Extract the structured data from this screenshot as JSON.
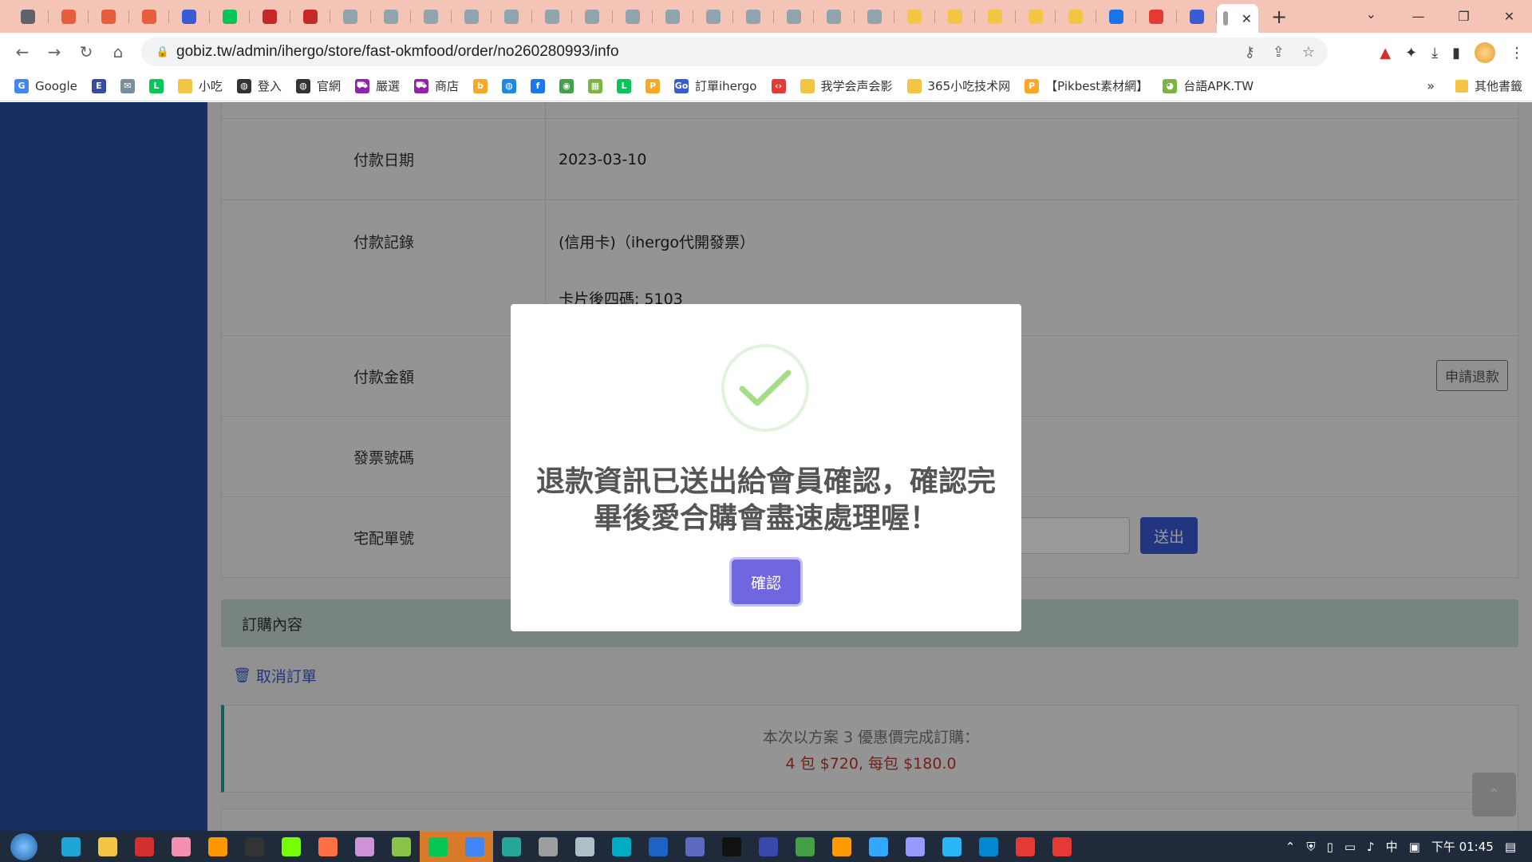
{
  "browser": {
    "tabs": [
      {
        "icon": "globe-icon",
        "color": "#5f6368"
      },
      {
        "icon": "shop-icon",
        "color": "#e85d3b"
      },
      {
        "icon": "shop-icon",
        "color": "#e85d3b"
      },
      {
        "icon": "shop-icon",
        "color": "#e85d3b"
      },
      {
        "icon": "go-icon",
        "color": "#3a5bd6"
      },
      {
        "icon": "line-icon",
        "color": "#06c755"
      },
      {
        "icon": "pdf-icon",
        "color": "#c62828"
      },
      {
        "icon": "pdf-icon",
        "color": "#c62828"
      },
      {
        "icon": "cloud-icon",
        "color": "#90a4ae"
      },
      {
        "icon": "cloud-icon",
        "color": "#90a4ae"
      },
      {
        "icon": "cloud-icon",
        "color": "#90a4ae"
      },
      {
        "icon": "cloud-icon",
        "color": "#90a4ae"
      },
      {
        "icon": "cloud-icon",
        "color": "#90a4ae"
      },
      {
        "icon": "cloud-icon",
        "color": "#90a4ae"
      },
      {
        "icon": "cloud-icon",
        "color": "#90a4ae"
      },
      {
        "icon": "cloud-icon",
        "color": "#90a4ae"
      },
      {
        "icon": "cloud-icon",
        "color": "#90a4ae"
      },
      {
        "icon": "cloud-icon",
        "color": "#90a4ae"
      },
      {
        "icon": "cloud-icon",
        "color": "#90a4ae"
      },
      {
        "icon": "cloud-icon",
        "color": "#90a4ae"
      },
      {
        "icon": "cloud-icon",
        "color": "#90a4ae"
      },
      {
        "icon": "cloud-icon",
        "color": "#90a4ae"
      },
      {
        "icon": "folder-icon",
        "color": "#f4c542"
      },
      {
        "icon": "folder-icon",
        "color": "#f4c542"
      },
      {
        "icon": "folder-icon",
        "color": "#f4c542"
      },
      {
        "icon": "folder-icon",
        "color": "#f4c542"
      },
      {
        "icon": "folder-icon",
        "color": "#f4c542"
      },
      {
        "icon": "link-icon",
        "color": "#1a73e8"
      },
      {
        "icon": "youtube-icon",
        "color": "#e53935"
      },
      {
        "icon": "go-icon",
        "color": "#3a5bd6"
      }
    ],
    "active_tab_close": "✕",
    "url": "gobiz.tw/admin/ihergo/store/fast-okmfood/order/no260280993/info"
  },
  "bookmarks": [
    {
      "label": "Google",
      "icon": "google-icon",
      "color": "#4285f4",
      "glyph": "G"
    },
    {
      "label": "",
      "icon": "e-icon",
      "color": "#3949ab",
      "glyph": "E"
    },
    {
      "label": "",
      "icon": "mail-icon",
      "color": "#78909c",
      "glyph": "✉"
    },
    {
      "label": "",
      "icon": "line-icon",
      "color": "#06c755",
      "glyph": "L"
    },
    {
      "label": "小吃",
      "icon": "folder-icon",
      "color": "#f4c542",
      "glyph": ""
    },
    {
      "label": "登入",
      "icon": "globe-icon",
      "color": "#333333",
      "glyph": "◍"
    },
    {
      "label": "官網",
      "icon": "globe-icon",
      "color": "#333333",
      "glyph": "◍"
    },
    {
      "label": "嚴選",
      "icon": "cart-icon",
      "color": "#8e24aa",
      "glyph": "⛟"
    },
    {
      "label": "商店",
      "icon": "cart-icon",
      "color": "#8e24aa",
      "glyph": "⛟"
    },
    {
      "label": "",
      "icon": "b-icon",
      "color": "#f9a825",
      "glyph": "b"
    },
    {
      "label": "",
      "icon": "globe-icon",
      "color": "#1e88e5",
      "glyph": "◍"
    },
    {
      "label": "",
      "icon": "facebook-icon",
      "color": "#1877f2",
      "glyph": "f"
    },
    {
      "label": "",
      "icon": "chat-icon",
      "color": "#43a047",
      "glyph": "◉"
    },
    {
      "label": "",
      "icon": "sheet-icon",
      "color": "#7cb342",
      "glyph": "▦"
    },
    {
      "label": "",
      "icon": "line-icon",
      "color": "#06c755",
      "glyph": "L"
    },
    {
      "label": "",
      "icon": "p-icon",
      "color": "#f9a825",
      "glyph": "P"
    },
    {
      "label": "訂單ihergo",
      "icon": "go-icon",
      "color": "#3a5bd6",
      "glyph": "Go"
    },
    {
      "label": "",
      "icon": "code-icon",
      "color": "#e53935",
      "glyph": "‹›"
    },
    {
      "label": "我学会声会影",
      "icon": "folder-icon",
      "color": "#f4c542",
      "glyph": ""
    },
    {
      "label": "365小吃技术网",
      "icon": "folder-icon",
      "color": "#f4c542",
      "glyph": ""
    },
    {
      "label": "【Pikbest素材網】",
      "icon": "p-icon",
      "color": "#f9a825",
      "glyph": "P"
    },
    {
      "label": "台語APK.TW",
      "icon": "apk-icon",
      "color": "#7cb342",
      "glyph": "◕"
    }
  ],
  "bookmarks_more": "»",
  "bookmarks_other": "其他書籤",
  "order_info": {
    "rows": [
      {
        "label": "付款日期",
        "value": "2023-03-10"
      },
      {
        "label": "付款記錄",
        "value": "(信用卡)（ihergo代開發票）",
        "value2": "卡片後四碼: 5103"
      },
      {
        "label": "付款金額",
        "value": "",
        "action": "申請退款"
      },
      {
        "label": "發票號碼",
        "value": ""
      },
      {
        "label": "宅配單號",
        "value": "",
        "action": "送出"
      }
    ]
  },
  "order_section": {
    "header": "訂購內容",
    "cancel_label": "取消訂單",
    "promo_line1": "本次以方案 3 優惠價完成訂購：",
    "promo_line2": "4 包  $720, 每包 $180.0"
  },
  "modal": {
    "message": "退款資訊已送出給會員確認，確認完畢後愛合購會盡速處理喔！",
    "confirm_label": "確認"
  },
  "taskbar": {
    "apps": [
      {
        "icon": "edge-icon",
        "color": "#1fa4d8"
      },
      {
        "icon": "explorer-icon",
        "color": "#f4c542"
      },
      {
        "icon": "store-icon",
        "color": "#d32f2f"
      },
      {
        "icon": "app-icon",
        "color": "#f48fb1"
      },
      {
        "icon": "app-icon",
        "color": "#ff9800"
      },
      {
        "icon": "video-icon",
        "color": "#333333"
      },
      {
        "icon": "app-icon",
        "color": "#76ff03"
      },
      {
        "icon": "app-icon",
        "color": "#ff7043"
      },
      {
        "icon": "music-icon",
        "color": "#ce93d8"
      },
      {
        "icon": "app-icon",
        "color": "#8bc34a"
      },
      {
        "icon": "line-icon",
        "color": "#06c755",
        "highlight": true
      },
      {
        "icon": "chrome-icon",
        "color": "#4285f4",
        "highlight": true
      },
      {
        "icon": "paint-icon",
        "color": "#26a69a"
      },
      {
        "icon": "settings-icon",
        "color": "#9e9e9e"
      },
      {
        "icon": "app-icon",
        "color": "#b0bec5"
      },
      {
        "icon": "app-icon",
        "color": "#00acc1"
      },
      {
        "icon": "word-icon",
        "color": "#1e63c4"
      },
      {
        "icon": "app-icon",
        "color": "#5c6bc0"
      },
      {
        "icon": "qq-icon",
        "color": "#111111"
      },
      {
        "icon": "app-icon",
        "color": "#3949ab"
      },
      {
        "icon": "app-icon",
        "color": "#43a047"
      },
      {
        "icon": "illustrator-icon",
        "color": "#ff9a00"
      },
      {
        "icon": "photoshop-icon",
        "color": "#31a8ff"
      },
      {
        "icon": "aftereffects-icon",
        "color": "#9999ff"
      },
      {
        "icon": "app-icon",
        "color": "#29b6f6"
      },
      {
        "icon": "app-icon",
        "color": "#0288d1"
      },
      {
        "icon": "record-icon",
        "color": "#e53935"
      },
      {
        "icon": "app-icon",
        "color": "#e53935"
      }
    ],
    "tray_ime": "中",
    "clock": "下午 01:45"
  }
}
